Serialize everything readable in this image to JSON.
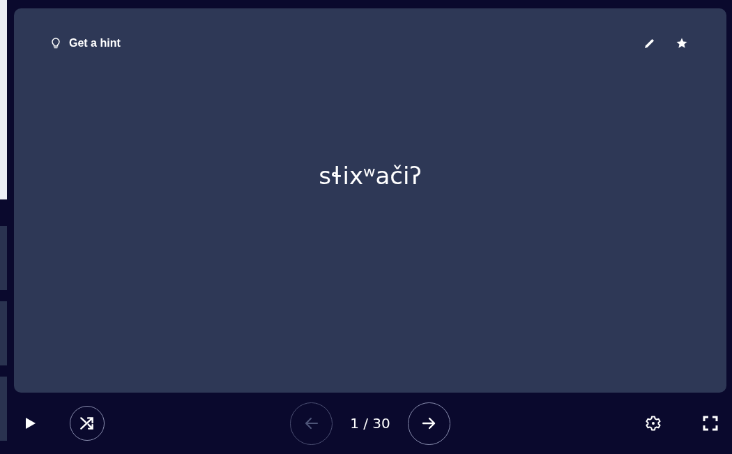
{
  "card": {
    "hint_label": "Get a hint",
    "term": "sɬixʷačiʔ"
  },
  "navigation": {
    "previous": {
      "disabled": true
    },
    "counter": "1 / 30",
    "next": {
      "disabled": false
    }
  }
}
